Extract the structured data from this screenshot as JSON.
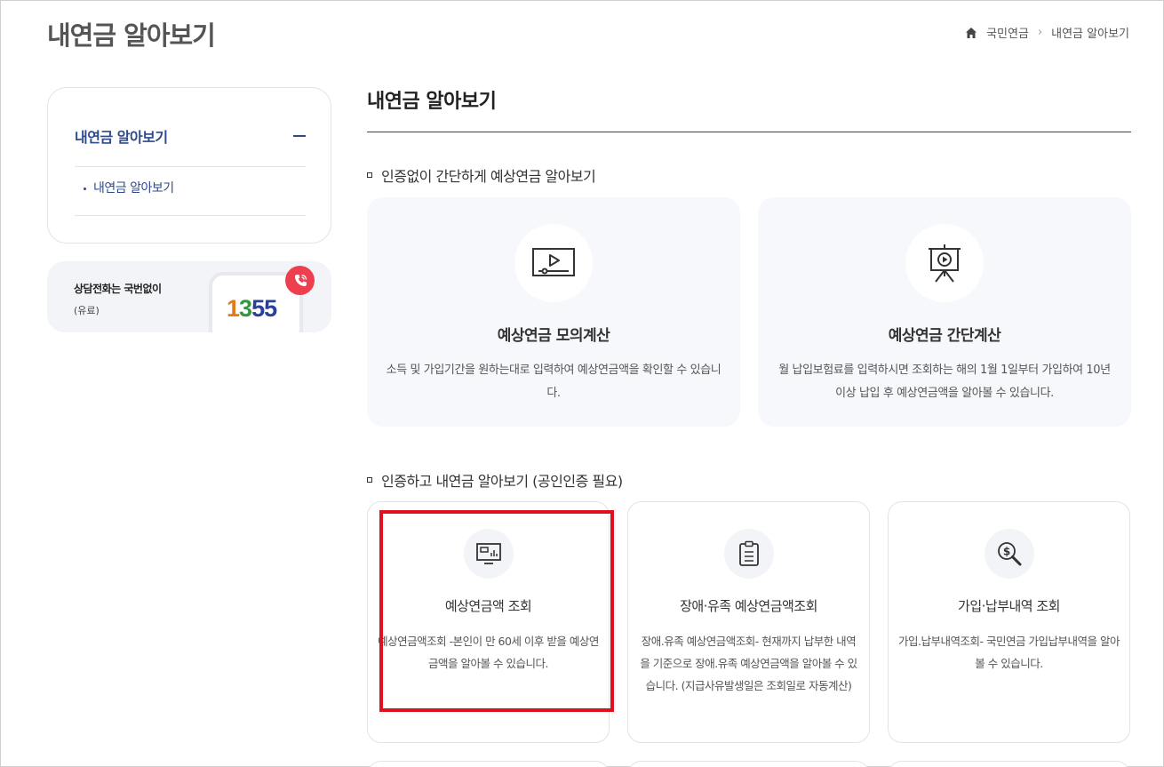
{
  "header": {
    "page_title": "내연금 알아보기",
    "breadcrumb": [
      "국민연금",
      "내연금 알아보기"
    ]
  },
  "sidebar": {
    "menu_title": "내연금 알아보기",
    "items": [
      {
        "label": "내연금 알아보기"
      }
    ],
    "call": {
      "title": "상담전화는 국번없이",
      "sub": "(유료)",
      "number_digits": [
        "1",
        "3",
        "5",
        "5"
      ],
      "digit_colors": [
        "#e07a1b",
        "#2f9a3a",
        "#2a3f9a",
        "#2a3f9a"
      ]
    }
  },
  "main": {
    "title": "내연금 알아보기",
    "section1": {
      "heading": "인증없이 간단하게 예상연금 알아보기",
      "cards": [
        {
          "icon": "video-play-icon",
          "title": "예상연금 모의계산",
          "desc": "소득 및 가입기간을 원하는대로 입력하여 예상연금액을 확인할 수 있습니다."
        },
        {
          "icon": "presentation-play-icon",
          "title": "예상연금 간단계산",
          "desc": "월 납입보험료를 입력하시면 조회하는 해의 1월 1일부터 가입하여 10년 이상 납입 후 예상연금액을 알아볼 수 있습니다."
        }
      ]
    },
    "section2": {
      "heading": "인증하고 내연금 알아보기 (공인인증 필요)",
      "cards": [
        {
          "icon": "monitor-chart-icon",
          "title": "예상연금액 조회",
          "desc": "예상연금액조회 -본인이 만 60세 이후 받을 예상연금액을 알아볼 수 있습니다."
        },
        {
          "icon": "clipboard-icon",
          "title": "장애·유족 예상연금액조회",
          "desc": "장애.유족 예상연금액조회- 현재까지 납부한 내역을 기준으로 장애.유족 예상연금액을 알아볼 수 있습니다. (지급사유발생일은 조회일로 자동계산)"
        },
        {
          "icon": "money-search-icon",
          "title": "가입·납부내역 조회",
          "desc": "가입.납부내역조회- 국민연금 가입납부내역을 알아볼 수 있습니다."
        }
      ]
    }
  },
  "colors": {
    "accent_navy": "#2d4a8c",
    "highlight_red": "#e0101e",
    "badge_red": "#ee3f4f"
  }
}
